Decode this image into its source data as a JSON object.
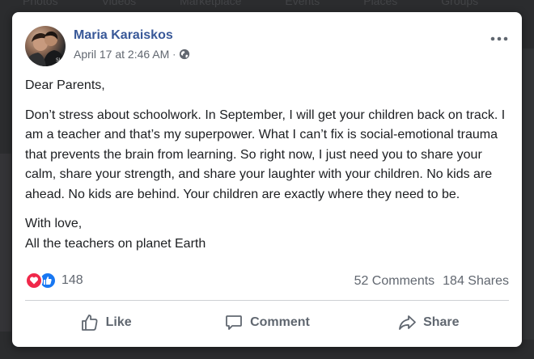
{
  "background": {
    "nav_items": [
      "Photos",
      "Videos",
      "Marketplace",
      "Events",
      "Places",
      "Groups"
    ]
  },
  "post": {
    "author": "Maria Karaiskos",
    "timestamp": "April 17 at 2:46 AM",
    "separator": "·",
    "privacy_icon": "globe-icon",
    "paragraphs": [
      "Dear Parents,",
      "Don’t stress about schoolwork. In September, I will get your children back on track. I am a teacher and that’s my superpower. What I can’t fix is social-emotional trauma that prevents the brain from learning. So right now, I just need you to share your calm, share your strength, and share your laughter with your children. No kids are ahead. No kids are behind. Your children are exactly where they need to be.",
      "With love,\nAll the teachers on planet Earth"
    ],
    "reactions": {
      "icons": [
        "love-reaction-icon",
        "like-reaction-icon"
      ],
      "count": "148"
    },
    "comments": "52 Comments",
    "shares": "184 Shares",
    "actions": {
      "like": "Like",
      "comment": "Comment",
      "share": "Share"
    }
  },
  "colors": {
    "author_link": "#385898",
    "meta_text": "#616770",
    "body_text": "#1c1e21",
    "love": "#f0284a",
    "like": "#1877f2"
  }
}
